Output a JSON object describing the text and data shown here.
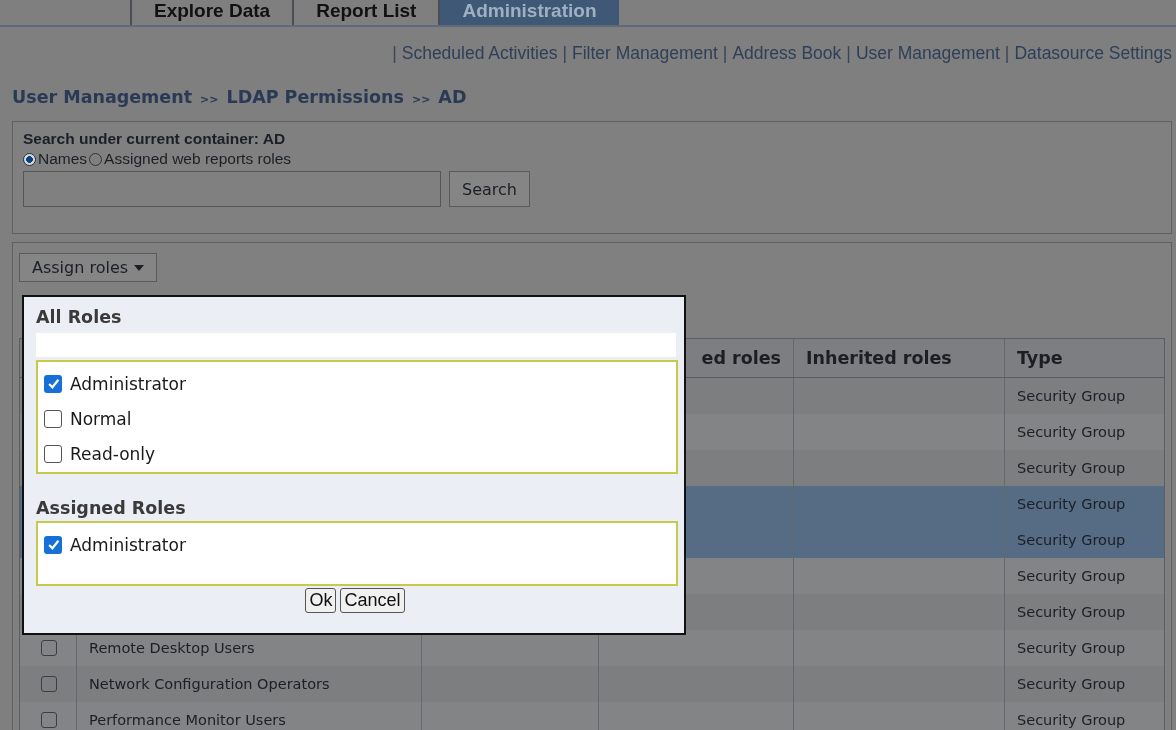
{
  "tabs": [
    {
      "label": "Explore Data",
      "selected": false
    },
    {
      "label": "Report List",
      "selected": false
    },
    {
      "label": "Administration",
      "selected": true
    }
  ],
  "subnav": [
    "Scheduled Activities",
    "Filter Management",
    "Address Book",
    "User Management",
    "Datasource Settings"
  ],
  "subnav_separator": "|",
  "breadcrumb": {
    "items": [
      "User Management",
      "LDAP Permissions",
      "AD"
    ],
    "separator": ">>"
  },
  "search": {
    "title": "Search under current container: AD",
    "options": [
      {
        "label": "Names",
        "selected": true
      },
      {
        "label": "Assigned web reports roles",
        "selected": false
      }
    ],
    "button": "Search"
  },
  "assign_button": {
    "label": "Assign roles"
  },
  "table": {
    "columns": [
      "ed roles",
      "Inherited roles",
      "Type"
    ],
    "rows": [
      {
        "name": null,
        "type": "Security Group",
        "selected": false,
        "checked": null
      },
      {
        "name": null,
        "type": "Security Group",
        "selected": false,
        "checked": null
      },
      {
        "name": null,
        "type": "Security Group",
        "selected": false,
        "checked": null
      },
      {
        "name": null,
        "type": "Security Group",
        "selected": true,
        "checked": null
      },
      {
        "name": null,
        "type": "Security Group",
        "selected": true,
        "checked": null
      },
      {
        "name": null,
        "type": "Security Group",
        "selected": false,
        "checked": null
      },
      {
        "name": null,
        "type": "Security Group",
        "selected": false,
        "checked": null
      },
      {
        "name": "Remote Desktop Users",
        "type": "Security Group",
        "selected": false,
        "checked": false
      },
      {
        "name": "Network Configuration Operators",
        "type": "Security Group",
        "selected": false,
        "checked": false
      },
      {
        "name": "Performance Monitor Users",
        "type": "Security Group",
        "selected": false,
        "checked": false
      }
    ]
  },
  "popup": {
    "all_title": "All Roles",
    "all_roles": [
      {
        "label": "Administrator",
        "checked": true
      },
      {
        "label": "Normal",
        "checked": false
      },
      {
        "label": "Read-only",
        "checked": false
      }
    ],
    "assigned_title": "Assigned Roles",
    "assigned_roles": [
      {
        "label": "Administrator",
        "checked": true
      }
    ],
    "buttons": [
      "Ok",
      "Cancel"
    ]
  }
}
